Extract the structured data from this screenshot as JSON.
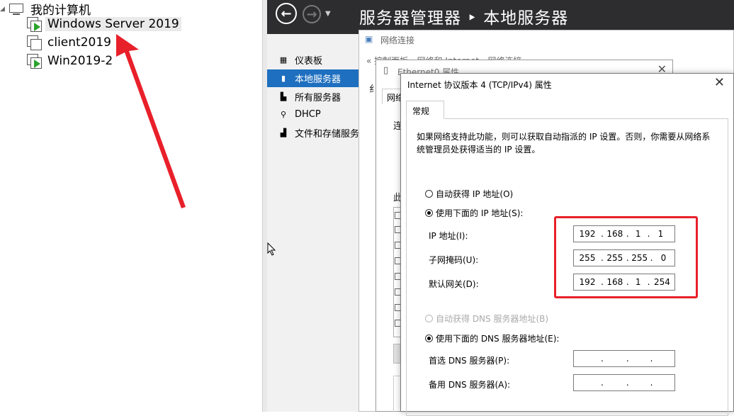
{
  "tree": {
    "root_label": "我的计算机",
    "vms": [
      {
        "label": "Windows Server 2019",
        "running": true,
        "selected": true
      },
      {
        "label": "client2019",
        "running": false,
        "selected": false
      },
      {
        "label": "Win2019-2",
        "running": true,
        "selected": false
      }
    ]
  },
  "server_manager": {
    "title": "服务器管理器 ‣ 本地服务器",
    "nav": [
      {
        "label": "仪表板",
        "icon": "dashboard-icon",
        "active": false
      },
      {
        "label": "本地服务器",
        "icon": "server-icon",
        "active": true
      },
      {
        "label": "所有服务器",
        "icon": "servers-icon",
        "active": false
      },
      {
        "label": "DHCP",
        "icon": "dhcp-icon",
        "active": false
      },
      {
        "label": "文件和存储服务",
        "icon": "storage-icon",
        "active": false
      }
    ]
  },
  "network_connections": {
    "title": "网络连接",
    "address": "« 控制面板 › 网络和 Internet › 网络连接"
  },
  "ethernet_props": {
    "title": "Ethernet0 属性",
    "tab": "网络",
    "text_connect": "连",
    "text_this": "此",
    "text_side": "纟"
  },
  "ipv4": {
    "title": "Internet 协议版本 4 (TCP/IPv4) 属性",
    "tab": "常规",
    "description": "如果网络支持此功能，则可以获取自动指派的 IP 设置。否则，你需要从网络系统管理员处获得适当的 IP 设置。",
    "auto_ip_label": "自动获得 IP 地址(O)",
    "manual_ip_label": "使用下面的 IP 地址(S):",
    "ip_label": "IP 地址(I):",
    "ip_value": [
      "192",
      "168",
      "1",
      "1"
    ],
    "mask_label": "子网掩码(U):",
    "mask_value": [
      "255",
      "255",
      "255",
      "0"
    ],
    "gateway_label": "默认网关(D):",
    "gateway_value": [
      "192",
      "168",
      "1",
      "254"
    ],
    "auto_dns_label": "自动获得 DNS 服务器地址(B)",
    "manual_dns_label": "使用下面的 DNS 服务器地址(E):",
    "preferred_dns_label": "首选 DNS 服务器(P):",
    "preferred_dns_value": [
      "",
      "",
      "",
      ""
    ],
    "alternate_dns_label": "备用 DNS 服务器(A):",
    "alternate_dns_value": [
      "",
      "",
      "",
      ""
    ]
  },
  "colors": {
    "highlight": "#e8202a",
    "arrow": "#e8202a",
    "nav_active": "#1e6fbf",
    "header_bg": "#2d2d30"
  }
}
